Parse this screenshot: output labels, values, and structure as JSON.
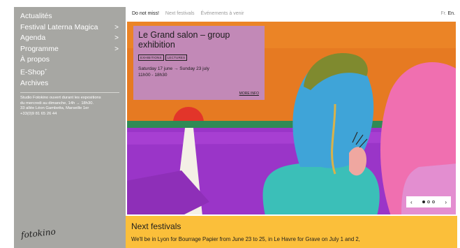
{
  "sidebar": {
    "items": [
      {
        "label": "Actualités",
        "has_submenu": false
      },
      {
        "label": "Festival Laterna Magica",
        "has_submenu": true
      },
      {
        "label": "Agenda",
        "has_submenu": true
      },
      {
        "label": "Programme",
        "has_submenu": true
      },
      {
        "label": "À propos",
        "has_submenu": false
      },
      {
        "label": "E-Shop",
        "has_submenu": false
      },
      {
        "label": "Archives",
        "has_submenu": false
      }
    ],
    "chevron": ">",
    "eshop_sup": "+",
    "info_lines": [
      "Studio Fotokino ouvert durant les expositions",
      "du mercredi au dimanche, 14h → 18h30.",
      "33 allée Léon Gambetta, Marseille 1er",
      "+33(0)9 81 65 26 44"
    ],
    "logo": "fotokino"
  },
  "topbar": {
    "tabs": [
      "Do not miss!",
      "Next festivals",
      "Événements à venir"
    ],
    "lang_fr": "Fr.",
    "lang_en": "En."
  },
  "card": {
    "title": "Le Grand salon – group exhibition",
    "tags": [
      "EXHIBITIONS",
      "LECTURES"
    ],
    "date_line1": "Saturday 17 june → Sunday 23 july",
    "date_line2": "11h00 - 18h30",
    "more": "MORE INFO"
  },
  "pager": {
    "prev": "‹",
    "next": "›",
    "total": 3,
    "current": 1
  },
  "next_festivals": {
    "heading": "Next festivals",
    "text": "We'll be in Lyon for Bourrage Papier from June 23 to 25, in Le Havre for Grave on July 1 and 2,"
  },
  "colors": {
    "sidebar": "#a7a7a3",
    "card": "#c289b7",
    "panel": "#fbbf3a",
    "sky": "#e67a22"
  }
}
